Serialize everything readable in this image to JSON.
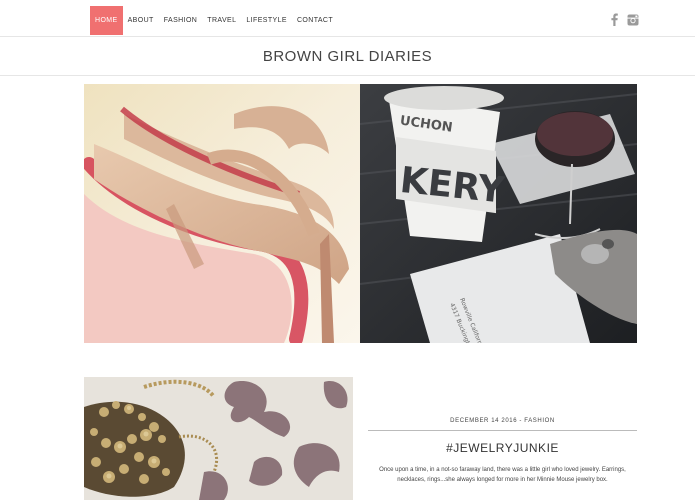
{
  "nav": {
    "items": [
      "HOME",
      "ABOUT",
      "FASHION",
      "TRAVEL",
      "LIFESTYLE",
      "CONTACT"
    ],
    "active_index": 0
  },
  "social": [
    "facebook-icon",
    "instagram-icon"
  ],
  "site_title": "BROWN GIRL DIARIES",
  "post": {
    "meta": "DECEMBER 14 2016 - FASHION",
    "title": "#JEWELRYJUNKIE",
    "excerpt": "Once upon a time, in a not-so faraway land, there was a little girl who loved jewelry. Earrings, necklaces, rings...she always longed for more in her Minnie Mouse jewelry box."
  },
  "colors": {
    "accent": "#f07070",
    "divider": "#e6e6e6"
  }
}
